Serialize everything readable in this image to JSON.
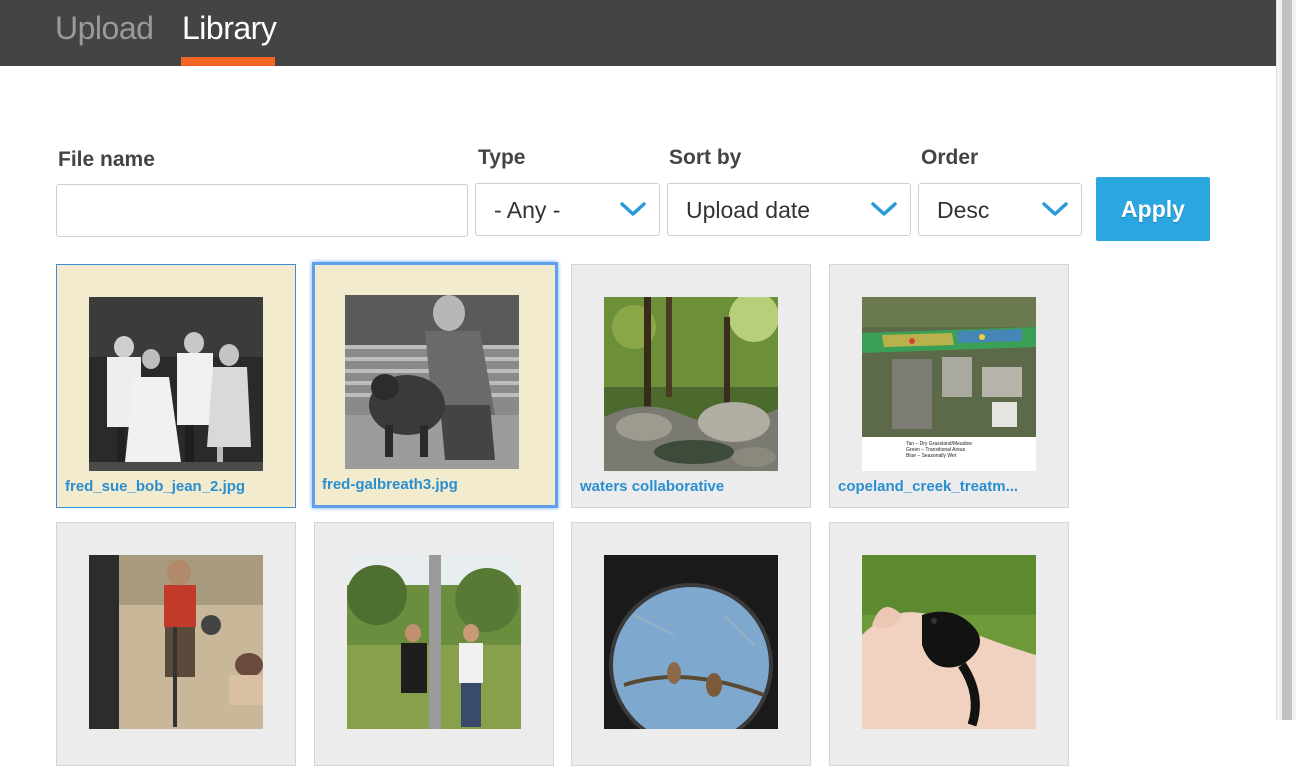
{
  "tabs": [
    {
      "label": "Upload",
      "active": false
    },
    {
      "label": "Library",
      "active": true
    }
  ],
  "filters": {
    "file_name": {
      "label": "File name",
      "value": "",
      "placeholder": ""
    },
    "type": {
      "label": "Type",
      "value": "- Any -"
    },
    "sort_by": {
      "label": "Sort by",
      "value": "Upload date"
    },
    "order": {
      "label": "Order",
      "value": "Desc"
    },
    "apply_label": "Apply"
  },
  "library": {
    "items": [
      {
        "caption": "fred_sue_bob_jean_2.jpg",
        "selected": true
      },
      {
        "caption": "fred-galbreath3.jpg",
        "selected": true
      },
      {
        "caption": "waters collaborative",
        "selected": false
      },
      {
        "caption": "copeland_creek_treatm...",
        "selected": false
      },
      {
        "caption": "",
        "selected": false
      },
      {
        "caption": "",
        "selected": false
      },
      {
        "caption": "",
        "selected": false
      },
      {
        "caption": "",
        "selected": false
      }
    ],
    "map_legend": [
      "Tan – Dry Grassland/Meadow",
      "Green – Transitional Areas",
      "Blue – Seasonally Wet"
    ]
  },
  "colors": {
    "accent": "#f26522",
    "button": "#2aa6e0",
    "link": "#2a8fd0",
    "selected_bg": "#f3ebcd",
    "header_bg": "#444444"
  }
}
